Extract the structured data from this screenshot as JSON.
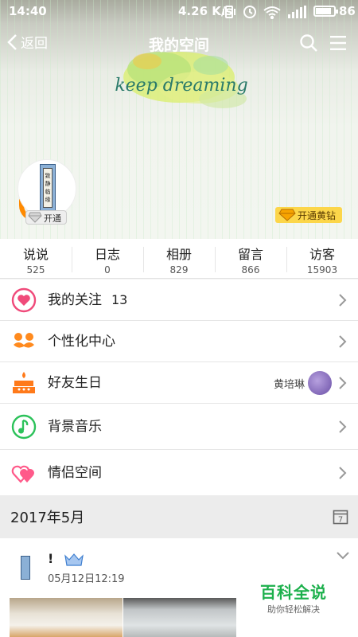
{
  "status_bar": {
    "time": "14:40",
    "speed": "4.26 K/s",
    "battery": "86",
    "battery_level": 0.86
  },
  "nav": {
    "back_label": "返回",
    "title": "我的空间"
  },
  "banner": {
    "text": "keep dreaming"
  },
  "avatar": {
    "book_text": "致静临缘"
  },
  "badges": {
    "open_label": "开通",
    "yellow_diamond_label": "开通黄钻"
  },
  "stats": [
    {
      "label": "说说",
      "value": "525"
    },
    {
      "label": "日志",
      "value": "0"
    },
    {
      "label": "相册",
      "value": "829"
    },
    {
      "label": "留言",
      "value": "866"
    },
    {
      "label": "访客",
      "value": "15903"
    }
  ],
  "menu": [
    {
      "label": "我的关注",
      "count": "13",
      "icon": "heart-circle-icon",
      "color": "#f04a7a"
    },
    {
      "label": "个性化中心",
      "icon": "mustache-icon",
      "color": "#ff8a1e"
    },
    {
      "label": "好友生日",
      "icon": "birthday-cake-icon",
      "color": "#ff7a1a",
      "friend": "黄培琳"
    },
    {
      "label": "背景音乐",
      "icon": "music-note-icon",
      "color": "#2cc25a"
    },
    {
      "label": "情侣空间",
      "icon": "couple-hearts-icon",
      "color": "#ff5a8a"
    }
  ],
  "feed": {
    "month": "2017年5月",
    "calendar_day": "7",
    "post": {
      "name": "!",
      "date": "05月12日12:19"
    }
  },
  "watermark": {
    "title": "百科全说",
    "subtitle": "助你轻松解决"
  }
}
